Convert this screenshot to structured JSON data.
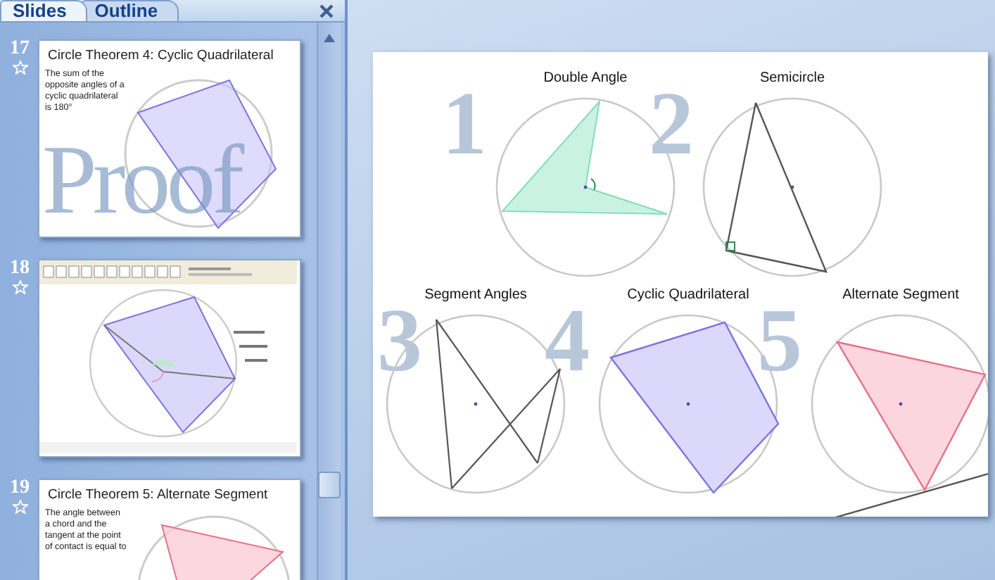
{
  "pane": {
    "tabs": [
      {
        "label": "Slides",
        "selected": true
      },
      {
        "label": "Outline",
        "selected": false
      }
    ]
  },
  "thumbnails": [
    {
      "number": "17",
      "kind": "quad",
      "title": "Circle Theorem 4: Cyclic Quadrilateral",
      "body": "The sum of the opposite angles of a cyclic quadrilateral is 180°",
      "watermark": "Proof"
    },
    {
      "number": "18",
      "kind": "app-screenshot"
    },
    {
      "number": "19",
      "kind": "tangent",
      "title": "Circle Theorem 5: Alternate Segment",
      "body": "The angle between a chord and the tangent at the point of contact is equal to"
    }
  ],
  "slide": {
    "rows": [
      [
        {
          "digit": "1",
          "title": "Double Angle",
          "kind": "double-angle"
        },
        {
          "digit": "2",
          "title": "Semicircle",
          "kind": "semicircle"
        }
      ],
      [
        {
          "digit": "3",
          "title": "Segment Angles",
          "kind": "segment"
        },
        {
          "digit": "4",
          "title": "Cyclic Quadrilateral",
          "kind": "quad"
        },
        {
          "digit": "5",
          "title": "Alternate Segment",
          "kind": "tangent"
        }
      ]
    ]
  }
}
